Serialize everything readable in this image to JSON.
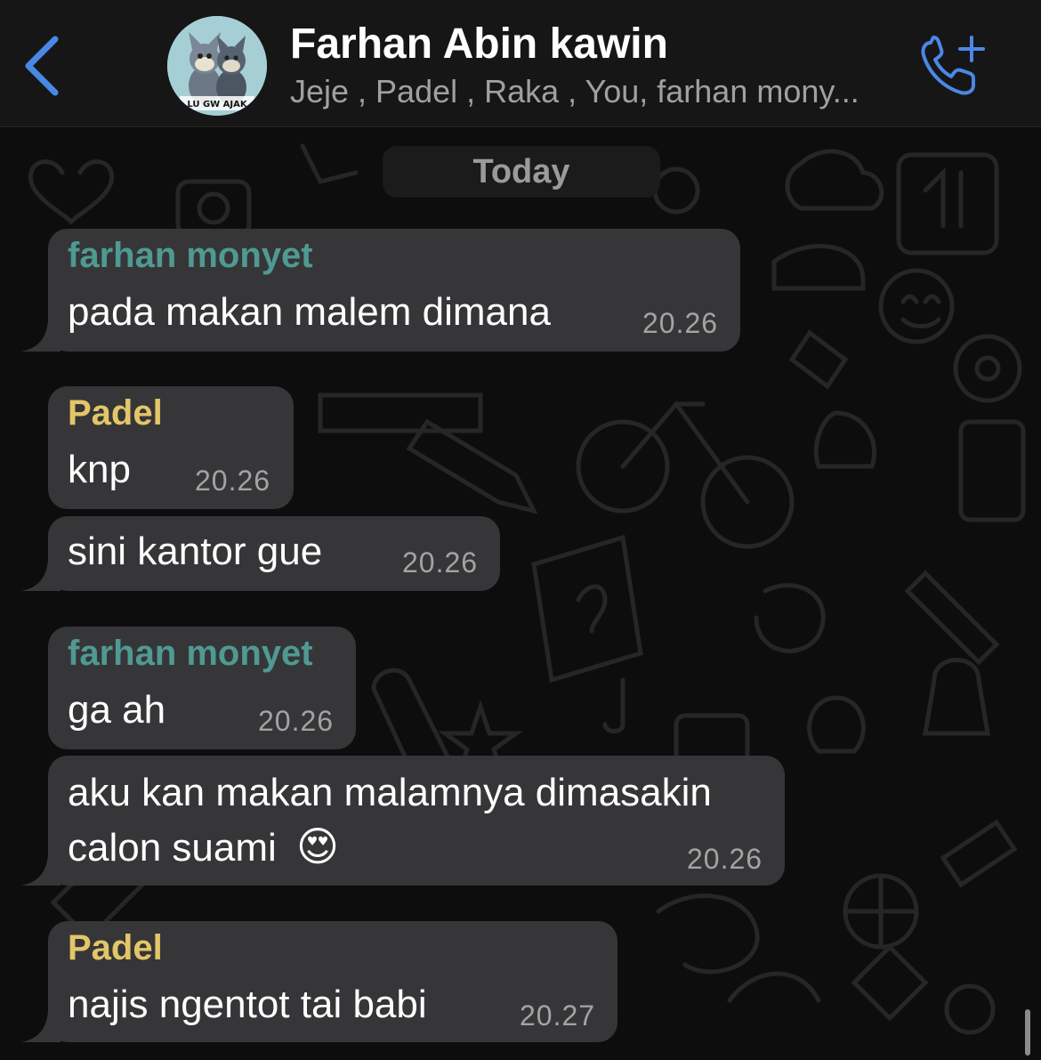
{
  "header": {
    "title": "Farhan Abin kawin",
    "subtitle": "Jeje , Padel , Raka , You, farhan mony...",
    "avatar_caption": "LU GW AJAK",
    "back_icon": "chevron-left-icon",
    "call_icon": "add-call-icon"
  },
  "chat": {
    "date_label": "Today",
    "messages": [
      {
        "sender": "farhan monyet",
        "text": "pada makan malem dimana",
        "time": "20.26"
      },
      {
        "sender": "Padel",
        "text": "knp",
        "time": "20.26"
      },
      {
        "sender": "",
        "text": "sini kantor gue",
        "time": "20.26"
      },
      {
        "sender": "farhan monyet",
        "text": "ga ah",
        "time": "20.26"
      },
      {
        "sender": "",
        "text": "aku kan makan malamnya dimasakin",
        "text2": "calon suami",
        "emoji": "😍",
        "time": "20.26"
      },
      {
        "sender": "Padel",
        "text": "najis ngentot tai babi",
        "time": "20.27"
      }
    ]
  },
  "colors": {
    "accent": "#4a88e6",
    "bubble": "#363638",
    "sender_teal": "#4f9a93",
    "sender_yellow": "#e3c668"
  }
}
